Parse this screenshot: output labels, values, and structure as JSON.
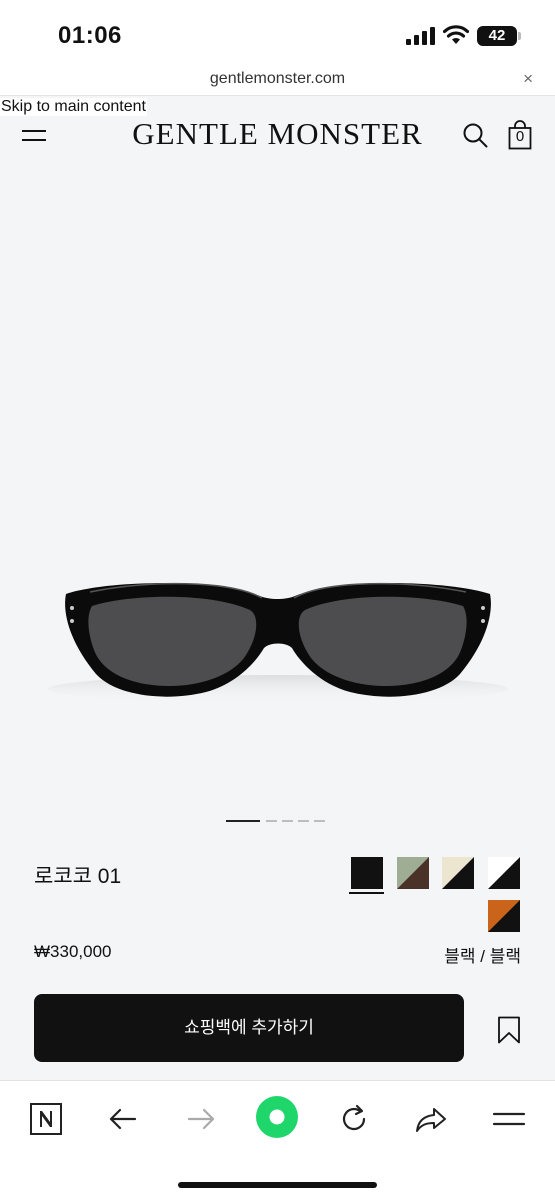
{
  "status_bar": {
    "time": "01:06",
    "battery": "42"
  },
  "browser": {
    "url": "gentlemonster.com",
    "close_label": "×"
  },
  "header": {
    "skip_link": "Skip to main content",
    "brand": "GENTLE MONSTER",
    "bag_count": "0"
  },
  "gallery": {
    "image_count": 6,
    "active_index": 0
  },
  "product": {
    "name": "로코코 01",
    "price": "₩330,000",
    "selected_color": "블랙 / 블랙",
    "add_to_bag_label": "쇼핑백에 추가하기",
    "swatches": [
      {
        "name": "black",
        "colors": [
          "#111111",
          "#111111"
        ]
      },
      {
        "name": "sage-brown",
        "colors": [
          "#9fad94",
          "#4a3228"
        ]
      },
      {
        "name": "cream-black",
        "colors": [
          "#ece5cf",
          "#111111"
        ]
      },
      {
        "name": "white-black",
        "colors": [
          "#ffffff",
          "#111111"
        ]
      },
      {
        "name": "black-orange",
        "colors": [
          "#c9641a",
          "#111111"
        ]
      }
    ]
  },
  "colors": {
    "accent_green": "#1fd66a",
    "stage_bg": "#f4f5f7"
  }
}
